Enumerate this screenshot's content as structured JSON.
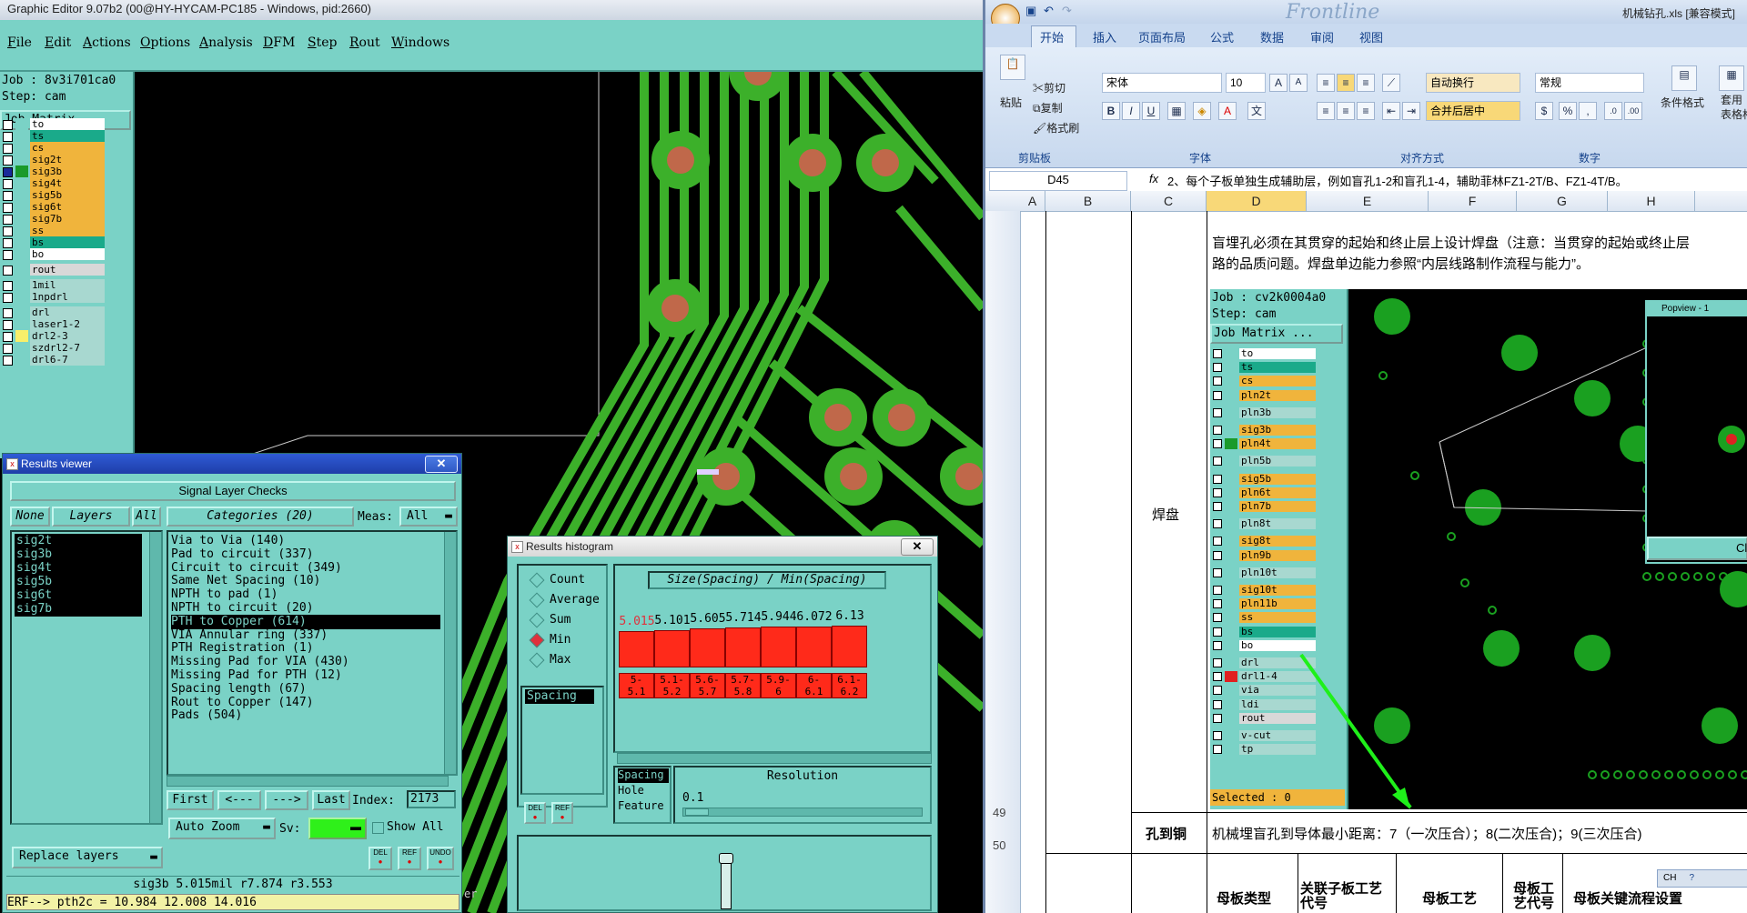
{
  "graphic_editor": {
    "title": "Graphic Editor 9.07b2 (00@HY-HYCAM-PC185 - Windows, pid:2660)",
    "menu": [
      "File",
      "Edit",
      "Actions",
      "Options",
      "Analysis",
      "DFM",
      "Step",
      "Rout",
      "Windows"
    ],
    "job": "Job : 8v3i701ca0",
    "step": "Step: cam",
    "job_matrix_label": "Job Matrix ...",
    "layers": [
      {
        "name": "to",
        "color": "#ffffff",
        "swatch": "#7ad2c6"
      },
      {
        "name": "ts",
        "color": "#1aaa8a",
        "swatch": "#7ad2c6"
      },
      {
        "name": "cs",
        "color": "#f0b43c",
        "swatch": "#7ad2c6"
      },
      {
        "name": "sig2t",
        "color": "#f0b43c",
        "swatch": "#7ad2c6"
      },
      {
        "name": "sig3b",
        "color": "#f0b43c",
        "swatch": "#1a9a2a",
        "selected": true
      },
      {
        "name": "sig4t",
        "color": "#f0b43c",
        "swatch": "#7ad2c6"
      },
      {
        "name": "sig5b",
        "color": "#f0b43c",
        "swatch": "#7ad2c6"
      },
      {
        "name": "sig6t",
        "color": "#f0b43c",
        "swatch": "#7ad2c6"
      },
      {
        "name": "sig7b",
        "color": "#f0b43c",
        "swatch": "#7ad2c6"
      },
      {
        "name": "ss",
        "color": "#f0b43c",
        "swatch": "#7ad2c6"
      },
      {
        "name": "bs",
        "color": "#1aaa8a",
        "swatch": "#7ad2c6"
      },
      {
        "name": "bo",
        "color": "#ffffff",
        "swatch": "#7ad2c6"
      },
      {
        "name": "rout",
        "color": "#d8d8d8",
        "swatch": "#7ad2c6",
        "gap": true
      },
      {
        "name": "1mil",
        "color": "#a8d8d0",
        "swatch": "#7ad2c6",
        "gap": true
      },
      {
        "name": "1npdrl",
        "color": "#a8d8d0",
        "swatch": "#7ad2c6"
      },
      {
        "name": "drl",
        "color": "#a8d8d0",
        "swatch": "#7ad2c6",
        "gap": true
      },
      {
        "name": "laser1-2",
        "color": "#a8d8d0",
        "swatch": "#7ad2c6"
      },
      {
        "name": "drl2-3",
        "color": "#a8d8d0",
        "swatch": "#f7ef6a"
      },
      {
        "name": "szdrl2-7",
        "color": "#a8d8d0",
        "swatch": "#7ad2c6"
      },
      {
        "name": "drl6-7",
        "color": "#a8d8d0",
        "swatch": "#7ad2c6"
      }
    ],
    "canvas_edge_label": "er"
  },
  "results_viewer": {
    "title": "Results viewer",
    "header": "Signal Layer Checks",
    "none_btn": "None",
    "layers_btn": "Layers",
    "all_btn": "All",
    "layers": [
      "sig2t",
      "sig3b",
      "sig4t",
      "sig5b",
      "sig6t",
      "sig7b"
    ],
    "categories_hdr": "Categories (20)",
    "meas_label": "Meas:",
    "meas_value": "All",
    "categories": [
      "Via to Via (140)",
      "Pad to circuit (337)",
      "Circuit to circuit (349)",
      "Same Net Spacing (10)",
      "NPTH to pad (1)",
      "NPTH to circuit (20)",
      "PTH to Copper (614)",
      "VIA Annular ring (337)",
      "PTH Registration (1)",
      "Missing Pad for VIA (430)",
      "Missing Pad for PTH (12)",
      "Spacing length (67)",
      "Rout to Copper (147)",
      "Pads (504)"
    ],
    "selected_category": "PTH to Copper (614)",
    "nav": {
      "first": "First",
      "prev": "<---",
      "next": "--->",
      "last": "Last",
      "index_label": "Index:",
      "index_value": "2173"
    },
    "auto_zoom": "Auto Zoom",
    "sv_label": "Sv:",
    "show_all": "Show All",
    "replace_layers": "Replace layers",
    "icons": [
      "DEL",
      "REF",
      "UNDO"
    ],
    "status": "sig3b  5.015mil   r7.874  r3.553",
    "erf": "ERF--> pth2c = 10.984 12.008 14.016"
  },
  "results_histogram": {
    "title": "Results histogram",
    "options": [
      {
        "label": "Count",
        "on": false
      },
      {
        "label": "Average",
        "on": false
      },
      {
        "label": "Sum",
        "on": false
      },
      {
        "label": "Min",
        "on": true
      },
      {
        "label": "Max",
        "on": false
      }
    ],
    "list_item": "Spacing",
    "chart_title": "Size(Spacing) / Min(Spacing)",
    "resolution_label": "Resolution",
    "resolution_value": "0.1",
    "field_list": [
      "Spacing",
      "Hole",
      "Feature"
    ],
    "icons": [
      "DEL",
      "REF"
    ]
  },
  "chart_data": {
    "type": "bar",
    "title": "Size(Spacing) / Min(Spacing)",
    "categories": [
      "5-\n5.1",
      "5.1-\n5.2",
      "5.6-\n5.7",
      "5.7-\n5.8",
      "5.9-\n6",
      "6-\n6.1",
      "6.1-\n6.2"
    ],
    "category_labels": [
      [
        "5-",
        "5.1"
      ],
      [
        "5.1-",
        "5.2"
      ],
      [
        "5.6-",
        "5.7"
      ],
      [
        "5.7-",
        "5.8"
      ],
      [
        "5.9-",
        "6"
      ],
      [
        "6-",
        "6.1"
      ],
      [
        "6.1-",
        "6.2"
      ]
    ],
    "value_labels": [
      "5.015",
      "5.101",
      "5.605",
      "5.714",
      "5.944",
      "6.072",
      "6.13"
    ],
    "values": [
      5.015,
      5.101,
      5.605,
      5.714,
      5.944,
      6.072,
      6.13
    ],
    "first_label_color": "#e0313c"
  },
  "excel": {
    "title": "机械钻孔.xls  [兼容模式]",
    "brand": "Frontline",
    "tabs": [
      "开始",
      "插入",
      "页面布局",
      "公式",
      "数据",
      "审阅",
      "视图"
    ],
    "clipboard": {
      "paste": "粘贴",
      "cut": "剪切",
      "copy": "复制",
      "format": "格式刷",
      "group": "剪贴板"
    },
    "font": {
      "name": "宋体",
      "size": "10",
      "group": "字体"
    },
    "align": {
      "wrap": "自动换行",
      "merge": "合并后居中",
      "group": "对齐方式"
    },
    "number": {
      "format": "常规",
      "group": "数字"
    },
    "styles": {
      "cond": "条件格式",
      "table": "套用\n表格格式"
    },
    "name_box": "D45",
    "fx": "fx",
    "formula": "2、每个子板单独生成辅助层，例如盲孔1-2和盲孔1-4，辅助菲林FZ1-2T/B、FZ1-4T/B。",
    "columns": [
      "A",
      "B",
      "C",
      "D",
      "E",
      "F",
      "G",
      "H"
    ],
    "rows": [
      "49",
      "50"
    ],
    "cell_pad_label": "焊盘",
    "cell_pad_text": "盲埋孔必须在其贯穿的起始和终止层上设计焊盘（注意：当贯穿的起始或终止层路的品质问题。焊盘单边能力参照“内层线路制作流程与能力”。",
    "cell_pad_text_line1": "盲埋孔必须在其贯穿的起始和终止层上设计焊盘（注意：当贯穿的起始或终止层",
    "cell_pad_text_line2": "路的品质问题。焊盘单边能力参照“内层线路制作流程与能力”。",
    "cell_hole_label": "孔到铜",
    "cell_hole_text": "机械埋盲孔到导体最小距离：7（一次压合）；8(二次压合)；9(三次压合)",
    "header_row": [
      "母板类型",
      "关联子板工艺代号",
      "母板工艺",
      "母板工艺代号",
      "母板关键流程设置"
    ],
    "ime": "CH",
    "embedded": {
      "job": "Job : cv2k0004a0",
      "step": "Step: cam",
      "job_matrix_label": "Job Matrix ...",
      "layers": [
        {
          "name": "to",
          "color": "#ffffff",
          "gap": false
        },
        {
          "name": "ts",
          "color": "#1aaa8a"
        },
        {
          "name": "cs",
          "color": "#f0b43c"
        },
        {
          "name": "pln2t",
          "color": "#f0b43c"
        },
        {
          "name": "pln3b",
          "color": "#a8d8d0",
          "gap": true
        },
        {
          "name": "sig3b",
          "color": "#f0b43c",
          "gap": true
        },
        {
          "name": "pln4t",
          "color": "#f0b43c",
          "swatch": "#1a9a2a"
        },
        {
          "name": "pln5b",
          "color": "#a8d8d0",
          "gap": true
        },
        {
          "name": "sig5b",
          "color": "#f0b43c",
          "gap": true
        },
        {
          "name": "pln6t",
          "color": "#f0b43c"
        },
        {
          "name": "pln7b",
          "color": "#f0b43c"
        },
        {
          "name": "pln8t",
          "color": "#a8d8d0",
          "gap": true
        },
        {
          "name": "sig8t",
          "color": "#f0b43c",
          "gap": true
        },
        {
          "name": "pln9b",
          "color": "#f0b43c"
        },
        {
          "name": "pln10t",
          "color": "#a8d8d0",
          "gap": true
        },
        {
          "name": "sig10t",
          "color": "#f0b43c",
          "gap": true
        },
        {
          "name": "pln11b",
          "color": "#f0b43c"
        },
        {
          "name": "ss",
          "color": "#f0b43c"
        },
        {
          "name": "bs",
          "color": "#1aaa8a"
        },
        {
          "name": "bo",
          "color": "#ffffff"
        },
        {
          "name": "drl",
          "color": "#a8d8d0",
          "gap": true
        },
        {
          "name": "drl1-4",
          "color": "#a8d8d0",
          "swatch": "#e02020"
        },
        {
          "name": "via",
          "color": "#a8d8d0"
        },
        {
          "name": "ldi",
          "color": "#a8d8d0"
        },
        {
          "name": "rout",
          "color": "#d8d8d8"
        },
        {
          "name": "v-cut",
          "color": "#a8d8d0",
          "gap": true
        },
        {
          "name": "tp",
          "color": "#a8d8d0"
        }
      ],
      "selected": "Selected : 0",
      "popview_title": "Popview - 1",
      "popview_btn": "Cl"
    }
  }
}
